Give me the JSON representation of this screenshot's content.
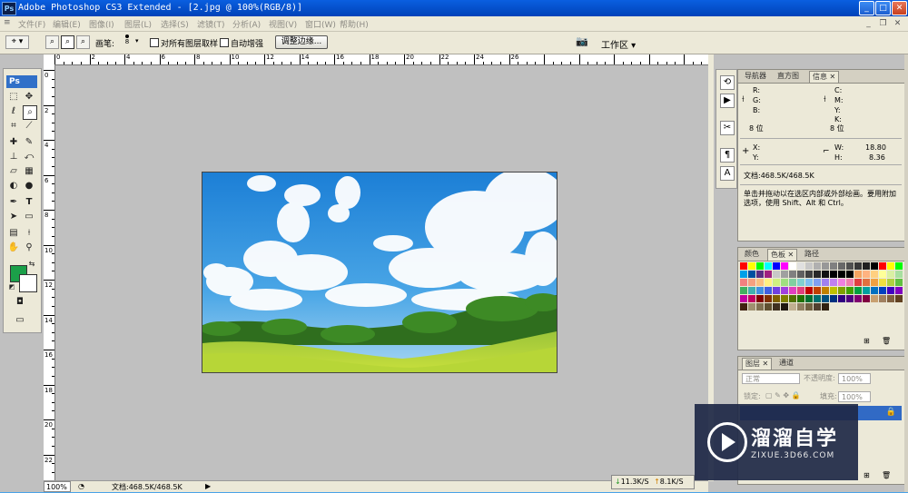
{
  "window": {
    "app_icon": "Ps",
    "title": "Adobe Photoshop CS3 Extended - [2.jpg @ 100%(RGB/8)]",
    "min": "_",
    "max": "□",
    "close": "✕"
  },
  "menubar": {
    "items": [
      "文件(F)",
      "编辑(E)",
      "图像(I)",
      "图层(L)",
      "选择(S)",
      "滤镜(T)",
      "分析(A)",
      "视图(V)",
      "窗口(W)",
      "帮助(H)"
    ]
  },
  "options": {
    "brush_label": "画笔:",
    "brush_size": "8",
    "sample_all_label": "对所有图层取样",
    "auto_enhance_label": "自动增强",
    "refine_edge_label": "调整边缘...",
    "workspace_label": "工作区 ▾"
  },
  "ruler": {
    "h_labels": [
      "0",
      "2",
      "4",
      "6",
      "8",
      "10",
      "12",
      "14",
      "16",
      "18",
      "20",
      "22",
      "24",
      "26"
    ],
    "v_labels": [
      "0",
      "2",
      "4",
      "6",
      "8",
      "10",
      "12",
      "14",
      "16",
      "18",
      "20",
      "22"
    ]
  },
  "toolbox": {
    "logo": "Ps"
  },
  "status": {
    "zoom": "100%",
    "doc": "文档:468.5K/468.5K",
    "down": "11.3K/S",
    "up": "8.1K/S"
  },
  "info_panel": {
    "tabs": [
      "导航器",
      "直方图",
      "信息"
    ],
    "active_tab": "信息",
    "left_channels": [
      "R:",
      "G:",
      "B:"
    ],
    "right_channels": [
      "C:",
      "M:",
      "Y:",
      "K:"
    ],
    "left_bits": "8 位",
    "right_bits": "8 位",
    "x_label": "X:",
    "y_label": "Y:",
    "w_label": "W:",
    "w_value": "18.80",
    "h_label": "H:",
    "h_value": "8.36",
    "doc": "文档:468.5K/468.5K",
    "hint": "单击并拖动以在选区内部或外部绘画。要用附加选项，使用 Shift、Alt 和 Ctrl。"
  },
  "swatches_panel": {
    "tabs": [
      "颜色",
      "色板",
      "路径"
    ],
    "active_tab": "色板"
  },
  "layers_panel": {
    "tabs": [
      "图层",
      "通道"
    ],
    "active_tab": "图层",
    "blend_mode": "正常",
    "opacity_label": "不透明度:",
    "opacity_value": "100%",
    "lock_label": "锁定:",
    "fill_label": "填充:",
    "fill_value": "100%"
  },
  "watermark": {
    "title": "溜溜自学",
    "url": "ZIXUE.3D66.COM"
  },
  "colors": {
    "foreground": "#1ba049",
    "background": "#ffffff",
    "titlebar": "#0a5fe0"
  }
}
